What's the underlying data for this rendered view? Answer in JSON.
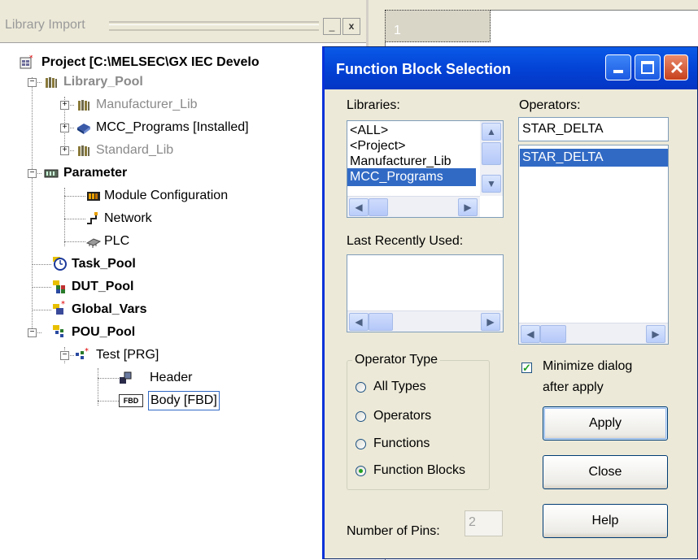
{
  "library_panel": {
    "title": "Library Import",
    "minimize_glyph": "_",
    "close_glyph": "x",
    "tree": {
      "project": "Project [C:\\MELSEC\\GX IEC Develo",
      "library_pool": "Library_Pool",
      "manufacturer_lib": "Manufacturer_Lib",
      "mcc_programs": "MCC_Programs [Installed]",
      "standard_lib": "Standard_Lib",
      "parameter": "Parameter",
      "module_configuration": "Module Configuration",
      "network": "Network",
      "plc": "PLC",
      "task_pool": "Task_Pool",
      "dut_pool": "DUT_Pool",
      "global_vars": "Global_Vars",
      "pou_pool": "POU_Pool",
      "test_prg": "Test [PRG]",
      "header": "Header",
      "body_fbd": "Body [FBD]",
      "fbd_icon_text": "FBD"
    }
  },
  "editor": {
    "tab_number": "1"
  },
  "dialog": {
    "title": "Function Block Selection",
    "libraries_label": "Libraries:",
    "libraries": [
      "<ALL>",
      "<Project>",
      "Manufacturer_Lib",
      "MCC_Programs"
    ],
    "selected_library": "MCC_Programs",
    "operators_label": "Operators:",
    "operator_filter": "STAR_DELTA",
    "operators": [
      "STAR_DELTA"
    ],
    "selected_operator": "STAR_DELTA",
    "last_recently_used_label": "Last Recently Used:",
    "operator_type": {
      "title": "Operator Type",
      "options": [
        "All Types",
        "Operators",
        "Functions",
        "Function Blocks"
      ],
      "selected": "Function Blocks"
    },
    "minimize_checkbox": {
      "line1": "Minimize dialog",
      "line2": "after apply",
      "checked": true
    },
    "buttons": {
      "apply": "Apply",
      "close": "Close",
      "help": "Help"
    },
    "number_of_pins_label": "Number of Pins:",
    "number_of_pins_value": "2"
  },
  "colors": {
    "titlebar_blue": "#0343d6",
    "selection_blue": "#316ac5",
    "dialog_face": "#ece9d8"
  }
}
